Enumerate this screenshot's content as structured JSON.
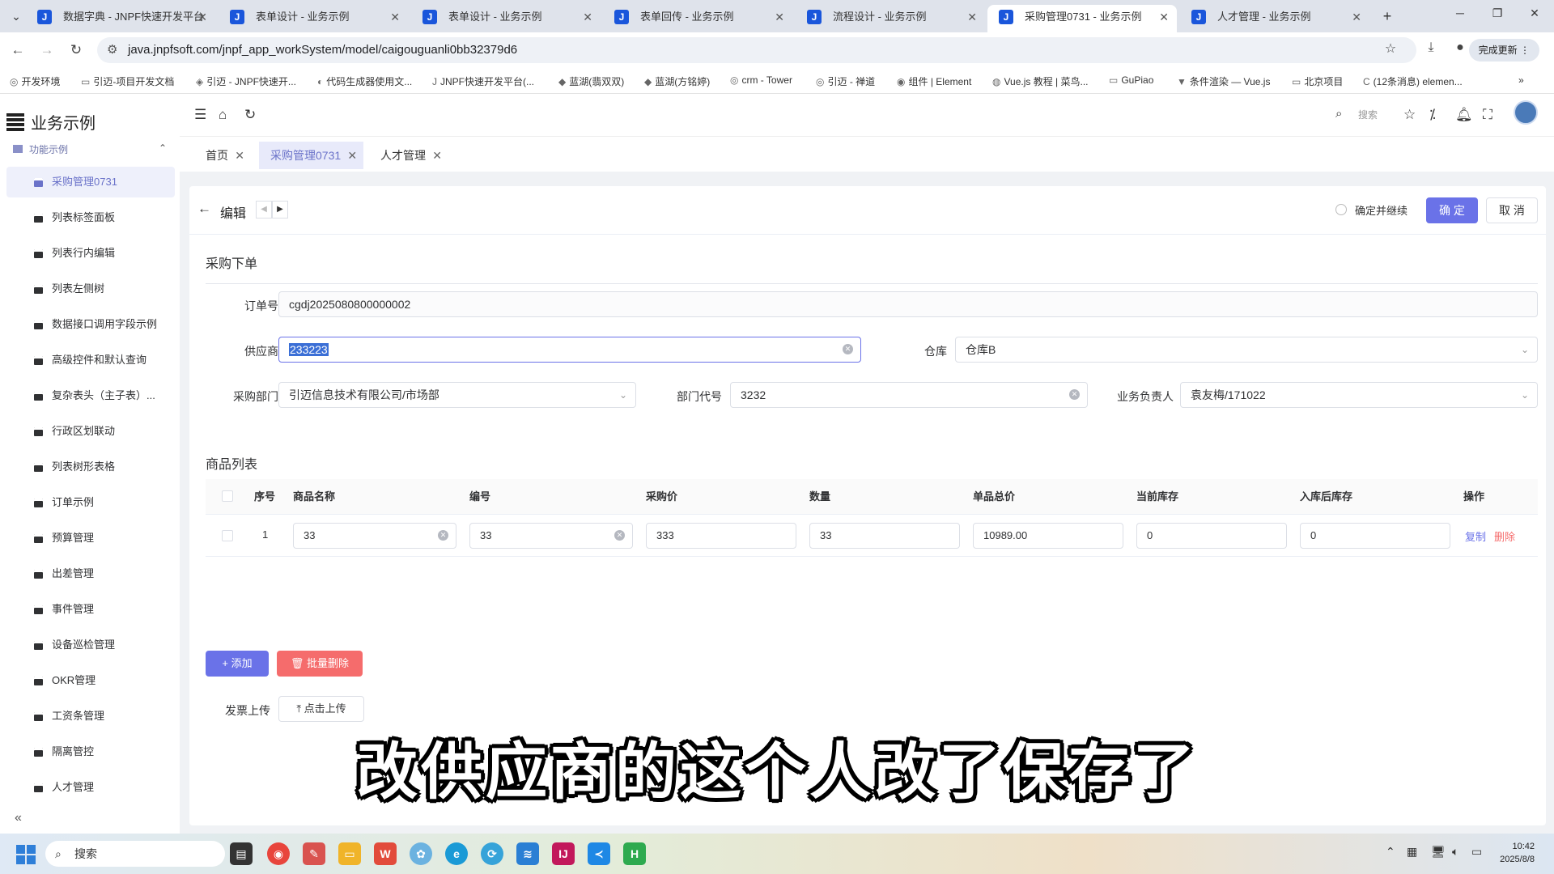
{
  "browser": {
    "tabs": [
      {
        "title": "数据字典 - JNPF快速开发平台",
        "active": false
      },
      {
        "title": "表单设计 - 业务示例",
        "active": false
      },
      {
        "title": "表单设计 - 业务示例",
        "active": false
      },
      {
        "title": "表单回传 - 业务示例",
        "active": false
      },
      {
        "title": "流程设计 - 业务示例",
        "active": false
      },
      {
        "title": "采购管理0731 - 业务示例",
        "active": true
      },
      {
        "title": "人才管理 - 业务示例",
        "active": false
      }
    ],
    "url": "java.jnpfsoft.com/jnpf_app_workSystem/model/caigouguanli0bb32379d6",
    "update_label": "完成更新",
    "bookmarks": [
      "开发环境",
      "引迈-项目开发文档",
      "引迈 - JNPF快速开...",
      "代码生成器使用文...",
      "JNPF快速开发平台(...",
      "蓝湖(翡双双)",
      "蓝湖(方铭婷)",
      "crm - Tower",
      "引迈 - 禅道",
      "组件 | Element",
      "Vue.js 教程 | 菜鸟...",
      "GuPiao",
      "条件渲染 — Vue.js",
      "北京项目",
      "(12条消息) elemen..."
    ]
  },
  "app": {
    "title": "业务示例",
    "group_label": "功能示例",
    "menu": [
      "采购管理0731",
      "列表标签面板",
      "列表行内编辑",
      "列表左侧树",
      "数据接口调用字段示例",
      "高级控件和默认查询",
      "复杂表头（主子表）...",
      "行政区划联动",
      "列表树形表格",
      "订单示例",
      "预算管理",
      "出差管理",
      "事件管理",
      "设备巡检管理",
      "OKR管理",
      "工资条管理",
      "隔离管控",
      "人才管理"
    ],
    "search_placeholder": "搜索"
  },
  "tags": [
    {
      "label": "首页",
      "active": false
    },
    {
      "label": "采购管理0731",
      "active": true
    },
    {
      "label": "人才管理",
      "active": false
    }
  ],
  "form": {
    "title": "编辑",
    "confirm_continue": "确定并继续",
    "ok": "确 定",
    "cancel": "取 消",
    "section_order": "采购下单",
    "order_no_label": "订单号",
    "order_no": "cgdj2025080800000002",
    "supplier_label": "供应商",
    "supplier": "233223",
    "warehouse_label": "仓库",
    "warehouse": "仓库B",
    "dept_label": "采购部门",
    "dept": "引迈信息技术有限公司/市场部",
    "dept_code_label": "部门代号",
    "dept_code": "3232",
    "owner_label": "业务负责人",
    "owner": "袁友梅/171022",
    "section_goods": "商品列表",
    "columns": [
      "序号",
      "商品名称",
      "编号",
      "采购价",
      "数量",
      "单品总价",
      "当前库存",
      "入库后库存",
      "操作"
    ],
    "rows": [
      {
        "index": "1",
        "name": "33",
        "code": "33",
        "price": "333",
        "qty": "33",
        "total": "10989.00",
        "stock": "0",
        "after": "0",
        "copy": "复制",
        "delete": "删除"
      }
    ],
    "add_label": "+ 添加",
    "batch_delete_label": "批量删除",
    "invoice_label": "发票上传",
    "upload_label": "点击上传"
  },
  "caption": "改供应商的这个人改了保存了",
  "taskbar": {
    "search_label": "搜索",
    "time": "10:42",
    "date": "2025/8/8"
  },
  "colors": {
    "primary": "#6a72e8",
    "danger": "#f56c6c",
    "menu_active": "#6a72c9"
  }
}
